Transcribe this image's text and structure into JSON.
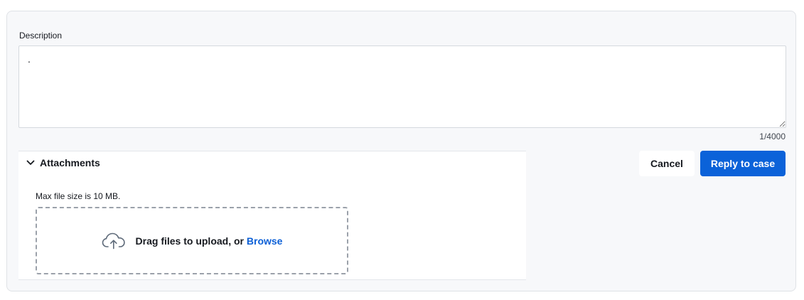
{
  "description": {
    "label": "Description",
    "value": ".",
    "char_count": "1/4000"
  },
  "attachments": {
    "title": "Attachments",
    "max_size_note": "Max file size is 10 MB.",
    "drop_text": "Drag files to upload, or",
    "browse_label": "Browse",
    "icon": "cloud-upload-icon"
  },
  "actions": {
    "cancel_label": "Cancel",
    "reply_label": "Reply to case"
  },
  "colors": {
    "primary": "#0b62d9",
    "link": "#0b5fd6",
    "panel_bg": "#f7f8fa"
  }
}
